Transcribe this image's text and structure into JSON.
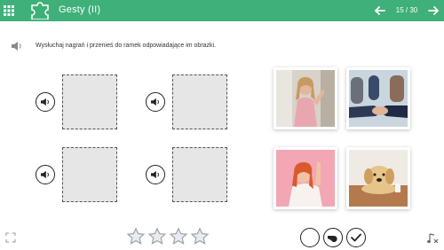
{
  "header": {
    "title": "Gesty (II)",
    "page_indicator": "15 / 30",
    "bg_color": "#3fb07a",
    "icons": [
      "grid-icon",
      "puzzle-icon",
      "arrow-left-icon",
      "arrow-right-icon"
    ]
  },
  "instruction": {
    "text": "Wysłuchaj nagrań i przenieś do ramek odpowiadające im obrazki.",
    "icon": "speaker-icon"
  },
  "drop_targets": [
    {
      "audio_icon": "speaker-icon"
    },
    {
      "audio_icon": "speaker-icon"
    },
    {
      "audio_icon": "speaker-icon"
    },
    {
      "audio_icon": "speaker-icon"
    }
  ],
  "images": [
    {
      "subject": "woman-waving"
    },
    {
      "subject": "handshake"
    },
    {
      "subject": "woman-pointing-up"
    },
    {
      "subject": "dog-on-table"
    }
  ],
  "footer": {
    "stars_total": 4,
    "controls": [
      "circle-icon",
      "whistle-icon",
      "check-icon"
    ],
    "corner_icons": [
      "fullscreen-icon",
      "music-off-icon"
    ]
  }
}
